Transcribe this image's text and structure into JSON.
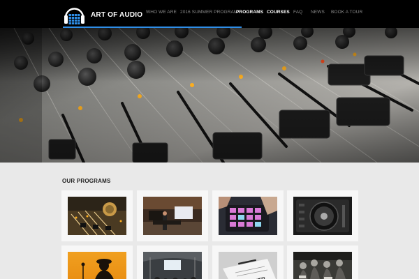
{
  "brand": {
    "name": "ART OF AUDIO",
    "accent": "#2e8de6"
  },
  "nav": {
    "items": [
      {
        "label": "WHO WE ARE",
        "active": false
      },
      {
        "label": "2016 SUMMER PROGRAM",
        "active": false
      },
      {
        "label": "PROGRAMS",
        "active": true
      },
      {
        "label": "COURSES",
        "active": true
      },
      {
        "label": "FAQ",
        "active": false
      },
      {
        "label": "NEWS",
        "active": false
      },
      {
        "label": "BOOK A TOUR",
        "active": false
      }
    ]
  },
  "programs": {
    "title": "OUR PROGRAMS",
    "cards": [
      {
        "icon": "mixing-console-photo"
      },
      {
        "icon": "recording-studio-photo"
      },
      {
        "icon": "drum-pad-controller-photo"
      },
      {
        "icon": "dj-turntable-photo"
      },
      {
        "icon": "singer-silhouette-photo"
      },
      {
        "icon": "live-venue-photo"
      },
      {
        "icon": "contract-document-photo"
      },
      {
        "icon": "band-crowd-photo"
      }
    ]
  }
}
